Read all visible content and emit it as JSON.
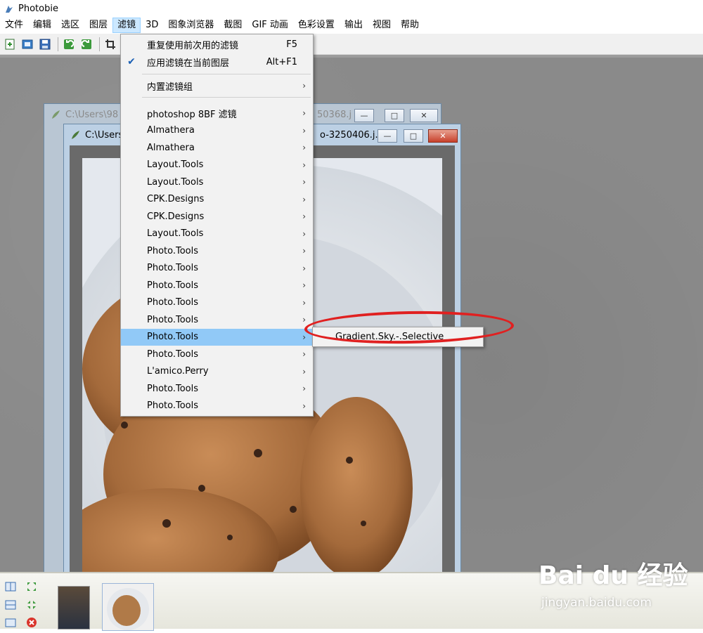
{
  "window": {
    "title": "Photobie"
  },
  "menubar": {
    "items": [
      "文件",
      "编辑",
      "选区",
      "图层",
      "滤镜",
      "3D",
      "图象浏览器",
      "截图",
      "GIF 动画",
      "色彩设置",
      "输出",
      "视图",
      "帮助"
    ],
    "active_index": 4
  },
  "toolbar": {
    "icons": [
      "new-image-icon",
      "open-icon",
      "save-icon",
      "undo-icon",
      "redo-icon",
      "crop-icon"
    ]
  },
  "documents": {
    "back": {
      "title": "C:\\Users\\98",
      "title_tail": "50368.j"
    },
    "front": {
      "title": "C:\\Users",
      "title_tail": "o-3250406.j..."
    }
  },
  "filter_menu": {
    "top_items": [
      {
        "label": "重复使用前次用的滤镜",
        "shortcut": "F5",
        "checked": false
      },
      {
        "label": "应用滤镜在当前图层",
        "shortcut": "Alt+F1",
        "checked": true
      }
    ],
    "builtin": {
      "label": "内置滤镜组"
    },
    "plugin_items": [
      "photoshop 8BF 滤镜",
      "Almathera",
      "Almathera",
      "Layout.Tools",
      "Layout.Tools",
      "CPK.Designs",
      "CPK.Designs",
      "Layout.Tools",
      "Photo.Tools",
      "Photo.Tools",
      "Photo.Tools",
      "Photo.Tools",
      "Photo.Tools",
      "Photo.Tools",
      "Photo.Tools",
      "L'amico.Perry",
      "Photo.Tools",
      "Photo.Tools"
    ],
    "highlighted_index": 13
  },
  "submenu": {
    "label": "Gradient.Sky.-.Selective"
  },
  "watermark": {
    "main": "Bai du 经验",
    "sub": "jingyan.baidu.com"
  },
  "colors": {
    "highlight": "#91c9f7",
    "annotation": "#e02020",
    "check": "#1a5fb4"
  }
}
